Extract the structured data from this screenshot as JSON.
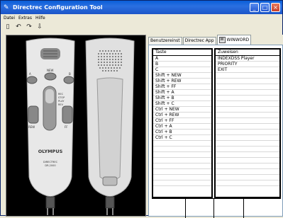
{
  "window": {
    "title": "Directrec Configuration Tool"
  },
  "menu": [
    "Datei",
    "Extras",
    "Hilfe"
  ],
  "toolbar_icons": [
    "new-file-icon",
    "undo-icon",
    "redo-icon",
    "download-icon"
  ],
  "device": {
    "front": {
      "buttons": {
        "a": "A",
        "new": "NEW",
        "b": "B",
        "rew": "REW",
        "ff": "FF"
      },
      "slide_labels": [
        "REC",
        "STOP",
        "PLAY",
        "REV"
      ],
      "brand": "OLYMPUS",
      "model_line1": "DIRECTREC",
      "model_line2": "DR-2000"
    }
  },
  "tabs": [
    {
      "label": "Benutzereinst"
    },
    {
      "label": "Directrec App"
    },
    {
      "label": "WINWORD",
      "active": true
    }
  ],
  "table": {
    "headers": {
      "key": "Taste",
      "assign": "Zuweisen"
    },
    "keys": [
      "A",
      "B",
      "C",
      "Shift + NEW",
      "Shift + REW",
      "Shift + FF",
      "Shift + A",
      "Shift + B",
      "Shift + C",
      "Ctrl + NEW",
      "Ctrl + REW",
      "Ctrl + FF",
      "Ctrl + A",
      "Ctrl + B",
      "Ctrl + C"
    ],
    "assignments": [
      "INDEXDSS Player",
      "PRIORITY",
      "EXIT"
    ]
  }
}
